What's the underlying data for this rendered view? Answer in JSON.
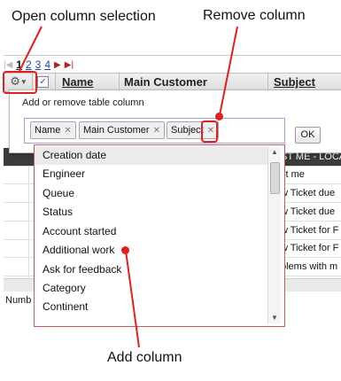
{
  "callouts": {
    "open_column_selection": "Open column selection",
    "remove_column": "Remove column",
    "add_column": "Add column"
  },
  "pager": {
    "pages": [
      "1",
      "2",
      "3",
      "4"
    ],
    "current": "1"
  },
  "table": {
    "columns": [
      "Name",
      "Main Customer",
      "Subject"
    ],
    "rows": [
      "ST ME - LOCA",
      "st me",
      "w Ticket due",
      "w Ticket due",
      "w Ticket for F",
      "w Ticket for F",
      "blems with m"
    ],
    "footer_text": "Numb"
  },
  "column_chooser": {
    "title": "Add or remove table column",
    "ok_label": "OK",
    "selected_columns": [
      "Name",
      "Main Customer",
      "Subject"
    ],
    "available_columns": [
      "Creation date",
      "Engineer",
      "Queue",
      "Status",
      "Account started",
      "Additional work",
      "Ask for feedback",
      "Category",
      "Continent"
    ],
    "highlighted_item": "Creation date"
  },
  "colors": {
    "annotation": "#e02020",
    "link": "#1a44b0"
  },
  "icons": {
    "settings": "gear-icon",
    "remove_chip": "close-icon"
  }
}
